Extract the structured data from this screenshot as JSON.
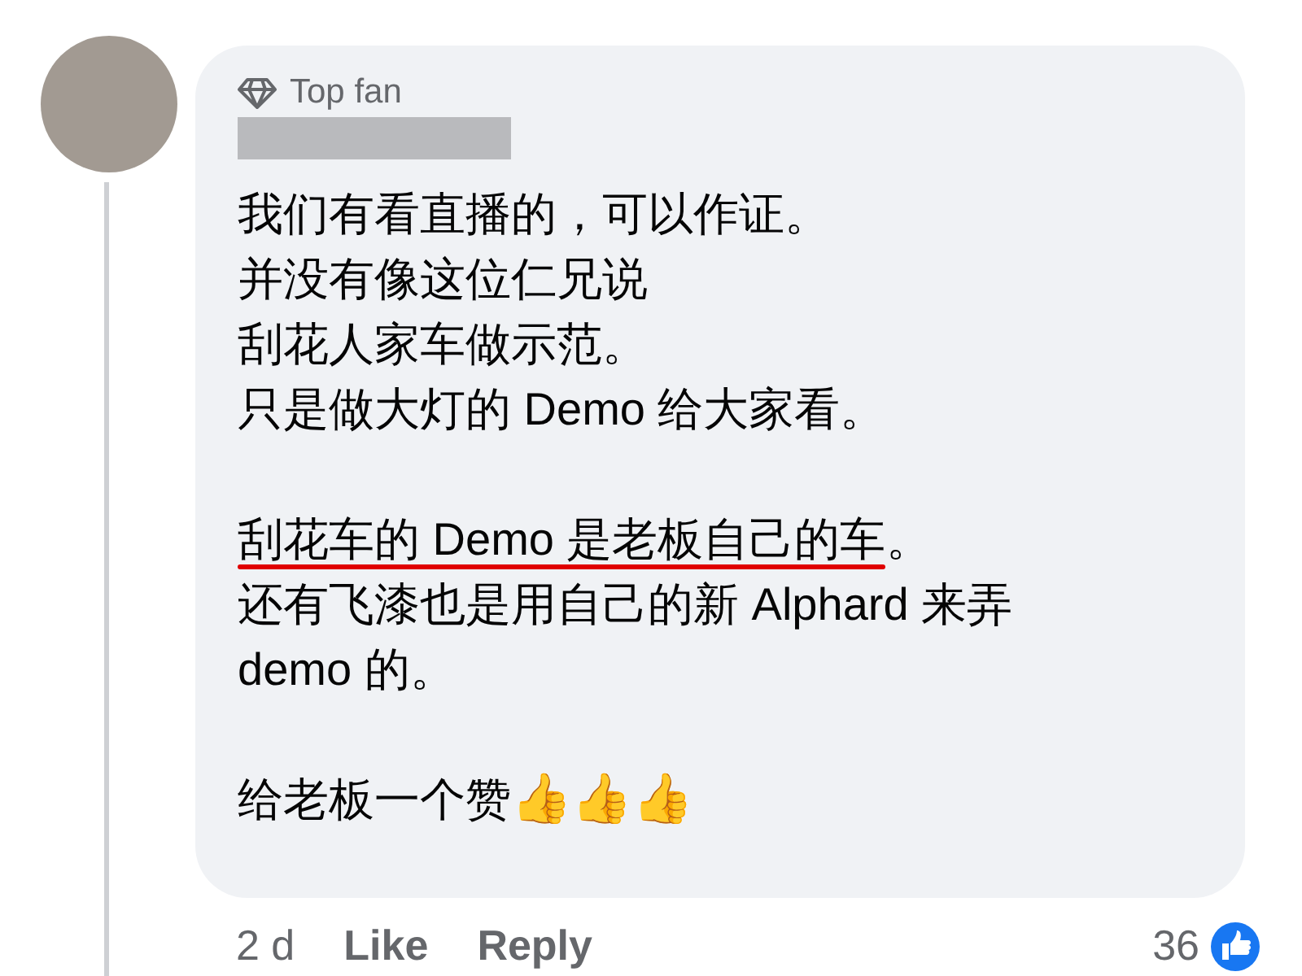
{
  "comment": {
    "badge": "Top fan",
    "paragraphs": [
      {
        "lines": [
          {
            "text": "我们有看直播的，可以作证。",
            "underlined": false
          },
          {
            "text": "并没有像这位仁兄说",
            "underlined": false
          },
          {
            "text": "刮花人家车做示范。",
            "underlined": false
          },
          {
            "text": "只是做大灯的 Demo 给大家看。",
            "underlined": false
          }
        ]
      },
      {
        "lines": [
          {
            "text": "刮花车的 Demo 是老板自己的车",
            "underlined": true,
            "tail": "。"
          },
          {
            "text": "还有飞漆也是用自己的新 Alphard 来弄",
            "underlined": false
          },
          {
            "text": "demo 的。",
            "underlined": false
          }
        ]
      },
      {
        "lines": [
          {
            "text": "给老板一个赞",
            "underlined": false,
            "emojis": "👍👍👍"
          }
        ]
      }
    ],
    "time": "2 d",
    "actions": [
      "Like",
      "Reply"
    ],
    "reaction_count": "36"
  }
}
